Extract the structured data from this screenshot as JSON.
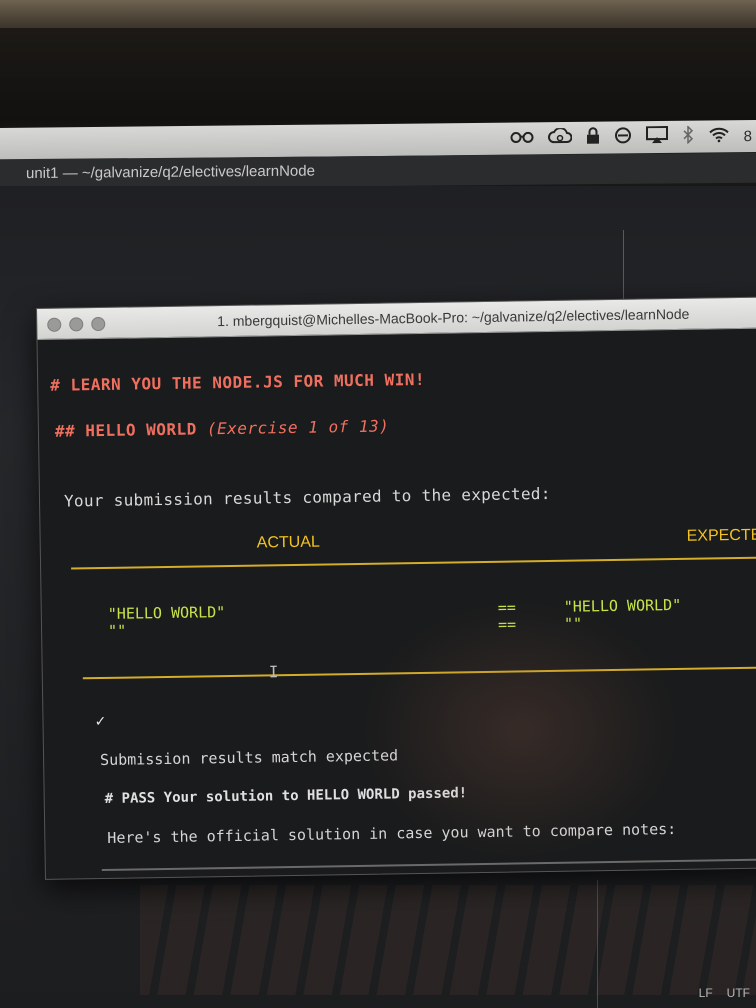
{
  "menubar": {
    "icons": [
      "glasses-icon",
      "creative-cloud-icon",
      "lock-icon",
      "dnd-icon",
      "airplay-icon",
      "bluetooth-icon",
      "wifi-icon"
    ],
    "clock_partial": "8"
  },
  "atom": {
    "window_title": "unit1 — ~/galvanize/q2/electives/learnNode",
    "status_line_ending": "LF",
    "status_encoding": "UTF"
  },
  "terminal": {
    "title": "1. mbergquist@Michelles-MacBook-Pro: ~/galvanize/q2/electives/learnNode",
    "heading1": "# LEARN YOU THE NODE.JS FOR MUCH WIN!",
    "heading2_prefix": "## HELLO WORLD ",
    "heading2_exercise": "(Exercise 1 of 13)",
    "compare_line": "Your submission results compared to the expected:",
    "col_actual": "ACTUAL",
    "col_expected": "EXPECTE",
    "rows": [
      {
        "actual": "\"HELLO WORLD\"",
        "op": "==",
        "expected": "\"HELLO WORLD\""
      },
      {
        "actual": "\"\"",
        "op": "==",
        "expected": "\"\""
      }
    ],
    "check_mark": "✓",
    "match_line": "Submission results match expected",
    "pass_line": "# PASS Your solution to HELLO WORLD passed!",
    "official_line": "Here's the official solution in case you want to compare notes:"
  },
  "colors": {
    "heading": "#f07060",
    "column_header": "#f4c322",
    "values": "#c6e44a",
    "rule": "#d4ad2a"
  }
}
